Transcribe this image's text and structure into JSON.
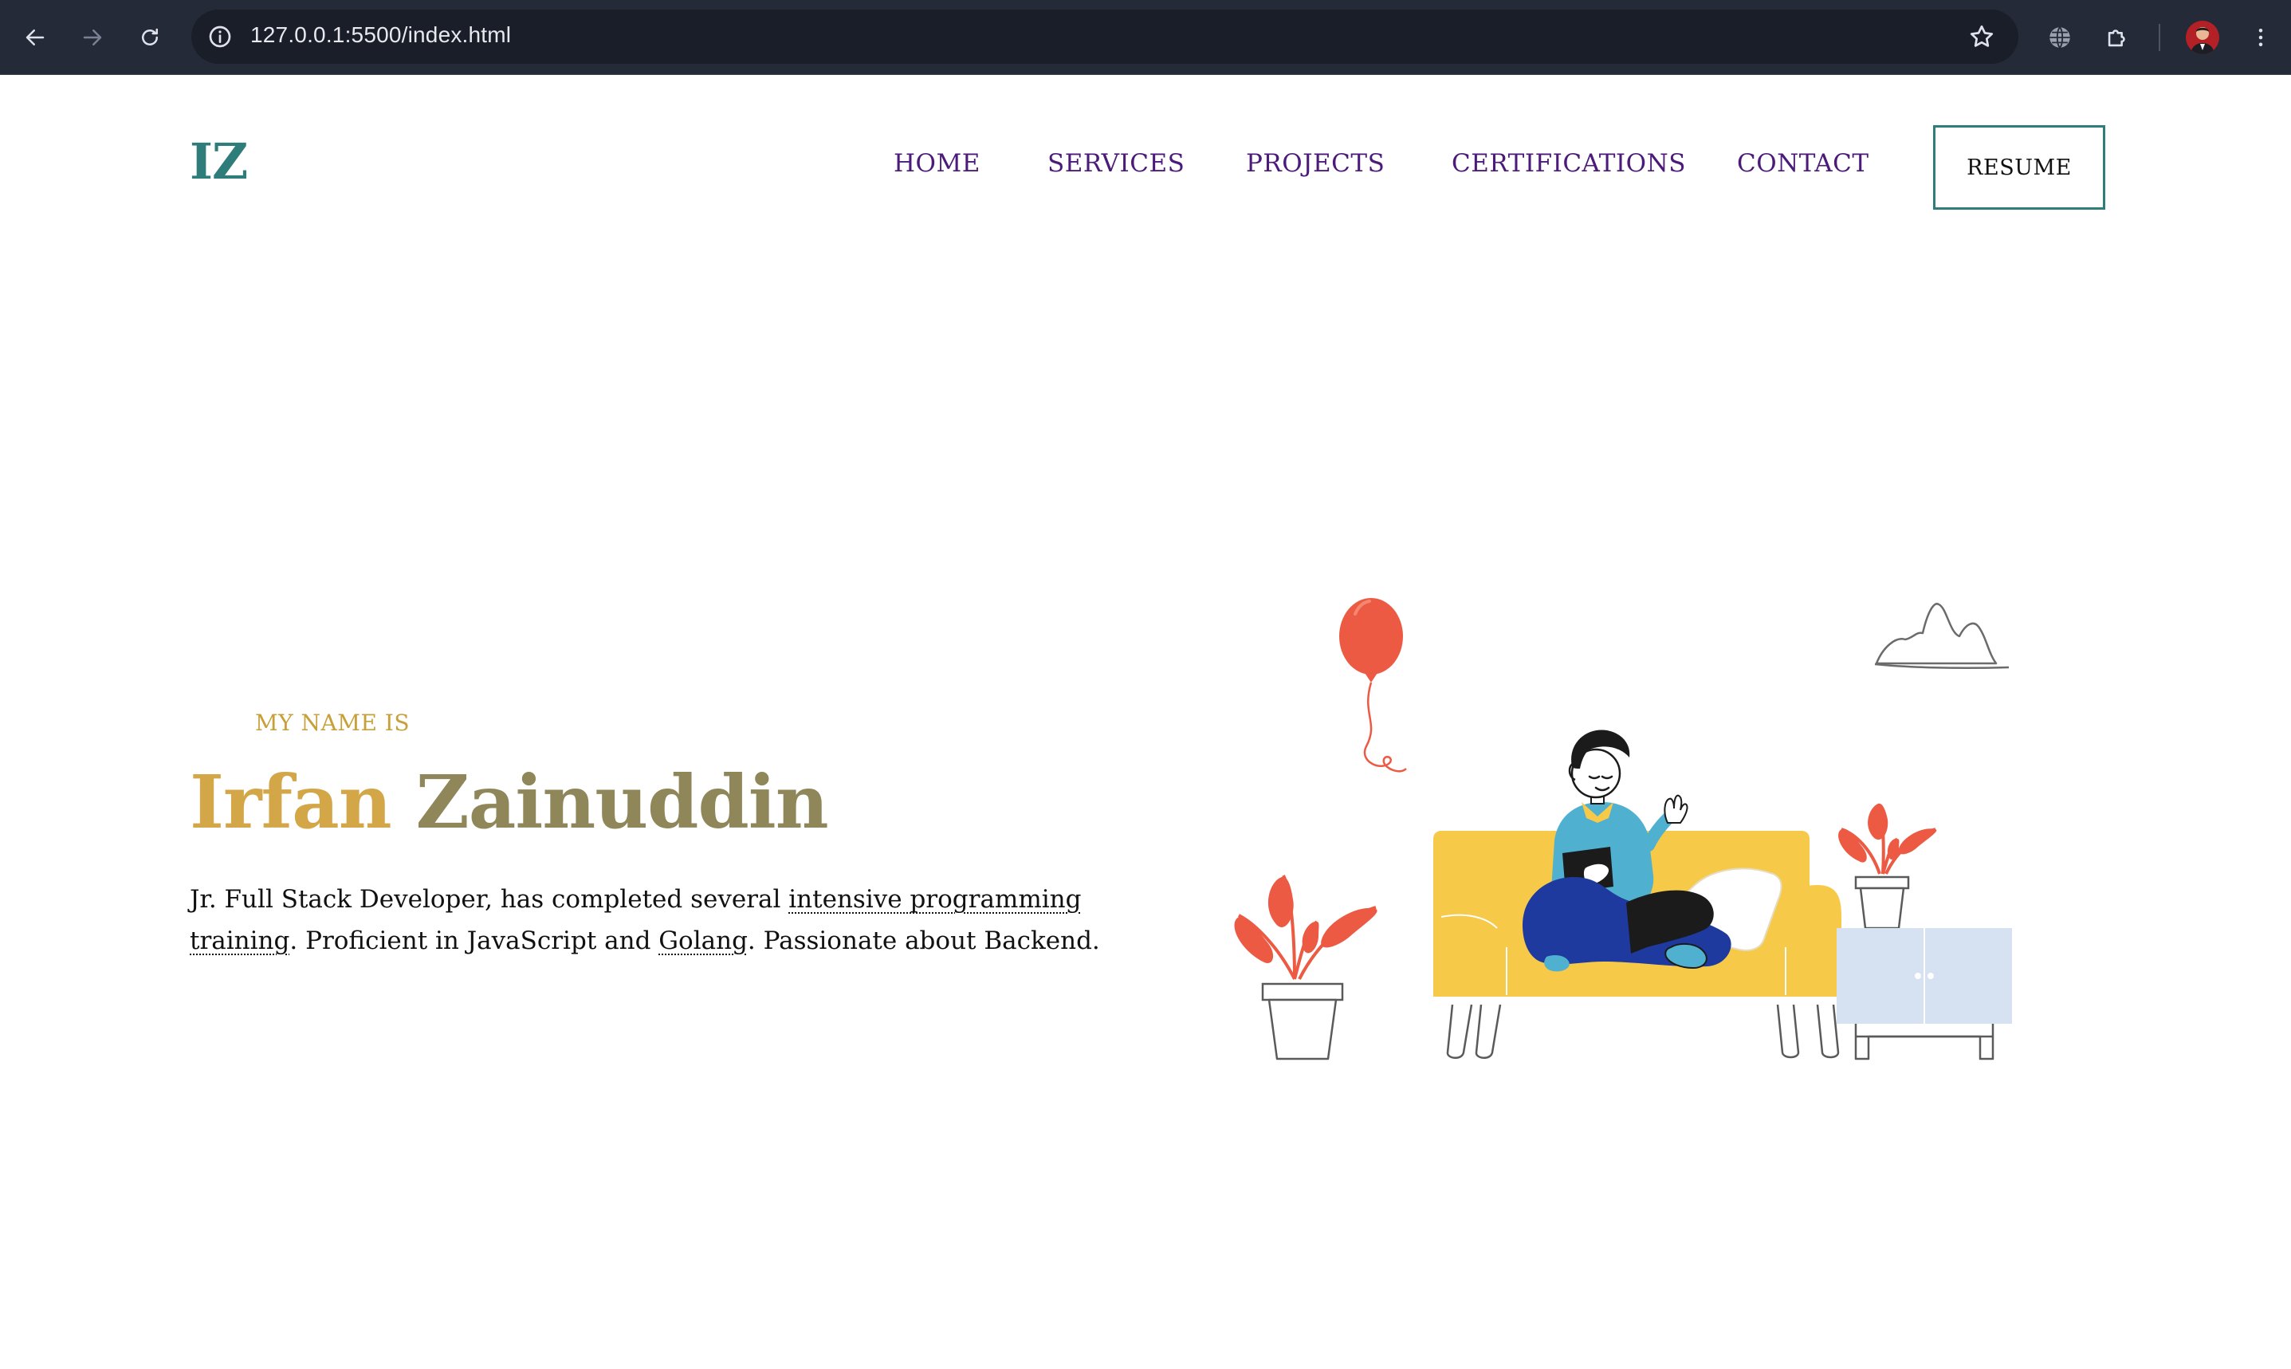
{
  "browser": {
    "url": "127.0.0.1:5500/index.html",
    "icons": {
      "back": "arrow-left-icon",
      "forward": "arrow-right-icon",
      "reload": "reload-icon",
      "site_info": "info-icon",
      "bookmark": "star-icon",
      "translate": "globe-icon",
      "extensions": "puzzle-icon",
      "menu": "kebab-menu-icon"
    }
  },
  "site": {
    "logo": "IZ",
    "nav": {
      "items": [
        "HOME",
        "SERVICES",
        "PROJECTS",
        "CERTIFICATIONS",
        "CONTACT"
      ],
      "resume_label": "RESUME"
    },
    "hero": {
      "eyebrow": "MY NAME IS",
      "first_name": "Irfan",
      "last_name": "Zainuddin",
      "bio": {
        "part1": "Jr. Full Stack Developer, has completed several ",
        "link1": "intensive programming training",
        "part2": ". Proficient in JavaScript and ",
        "link2": "Golang",
        "part3": ". Passionate about Backend."
      }
    },
    "colors": {
      "brand_teal": "#2f7d7a",
      "nav_purple": "#4b1a7a",
      "gold": "#d3a647",
      "olive": "#8f875a"
    }
  }
}
